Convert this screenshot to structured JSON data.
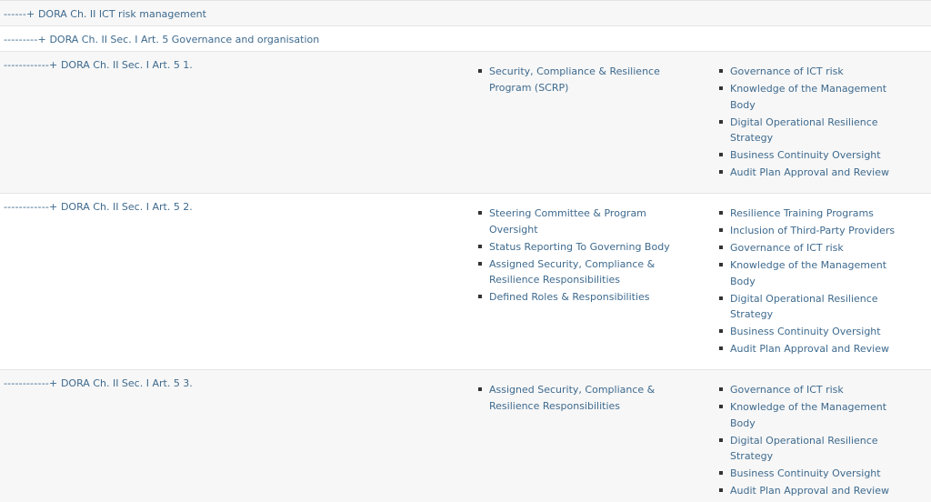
{
  "rows": [
    {
      "prefix": "------+",
      "label": "DORA Ch. II ICT risk management"
    },
    {
      "prefix": "---------+",
      "label": "DORA Ch. II Sec. I Art. 5 Governance and organisation"
    },
    {
      "prefix": "------------+",
      "label": "DORA Ch. II Sec. I Art. 5 1.",
      "controls": [
        "Security, Compliance & Resilience Program (SCRP)"
      ],
      "policies": [
        "Governance of ICT risk",
        "Knowledge of the Management Body",
        "Digital Operational Resilience Strategy",
        "Business Continuity Oversight",
        "Audit Plan Approval and Review"
      ]
    },
    {
      "prefix": "------------+",
      "label": "DORA Ch. II Sec. I Art. 5 2.",
      "controls": [
        "Steering Committee & Program Oversight",
        "Status Reporting To Governing Body",
        "Assigned Security, Compliance & Resilience Responsibilities",
        "Defined Roles & Responsibilities"
      ],
      "policies": [
        "Resilience Training Programs",
        "Inclusion of Third-Party Providers",
        "Governance of ICT risk",
        "Knowledge of the Management Body",
        "Digital Operational Resilience Strategy",
        "Business Continuity Oversight",
        "Audit Plan Approval and Review"
      ]
    },
    {
      "prefix": "------------+",
      "label": "DORA Ch. II Sec. I Art. 5 3.",
      "controls": [
        "Assigned Security, Compliance & Resilience Responsibilities"
      ],
      "policies": [
        "Governance of ICT risk",
        "Knowledge of the Management Body",
        "Digital Operational Resilience Strategy",
        "Business Continuity Oversight",
        "Audit Plan Approval and Review"
      ]
    }
  ]
}
